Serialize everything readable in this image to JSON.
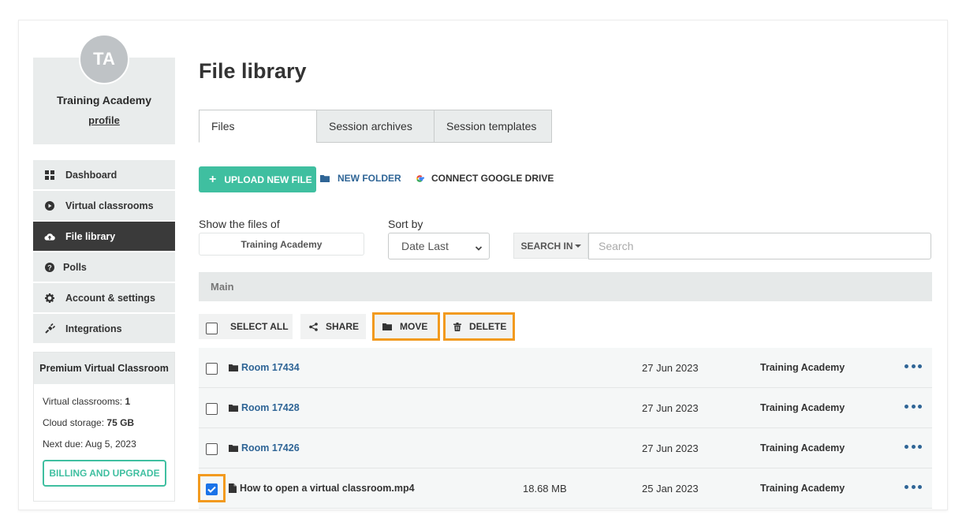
{
  "profile": {
    "initials": "TA",
    "name": "Training Academy",
    "link": "profile"
  },
  "nav": [
    {
      "label": "Dashboard",
      "icon": "dashboard-icon"
    },
    {
      "label": "Virtual classrooms",
      "icon": "play-circle-icon"
    },
    {
      "label": "File library",
      "icon": "cloud-upload-icon",
      "active": true
    },
    {
      "label": "Polls",
      "icon": "question-circle-icon"
    },
    {
      "label": "Account & settings",
      "icon": "gear-icon"
    },
    {
      "label": "Integrations",
      "icon": "plug-icon"
    }
  ],
  "plan": {
    "title": "Premium Virtual Classroom",
    "classrooms_label": "Virtual classrooms:",
    "classrooms_value": "1",
    "storage_label": "Cloud storage:",
    "storage_value": "75 GB",
    "next_due": "Next due: Aug 5, 2023",
    "billing_button": "BILLING AND UPGRADE"
  },
  "page": {
    "title": "File library"
  },
  "tabs": [
    {
      "label": "Files",
      "active": true
    },
    {
      "label": "Session archives"
    },
    {
      "label": "Session templates"
    }
  ],
  "toolbar": {
    "upload": "UPLOAD NEW FILE",
    "new_folder": "NEW FOLDER",
    "google_drive": "CONNECT GOOGLE DRIVE"
  },
  "filters": {
    "show_label": "Show the files of",
    "owner_value": "Training Academy",
    "sort_label": "Sort by",
    "sort_value": "Date Last",
    "search_in": "SEARCH IN",
    "search_placeholder": "Search"
  },
  "folder": {
    "name": "Main"
  },
  "actions": {
    "select_all": "SELECT ALL",
    "share": "SHARE",
    "move": "MOVE",
    "delete": "DELETE"
  },
  "files": [
    {
      "name": "Room 17434",
      "type": "folder",
      "size": "",
      "date": "27 Jun 2023",
      "owner": "Training Academy",
      "checked": false
    },
    {
      "name": "Room 17428",
      "type": "folder",
      "size": "",
      "date": "27 Jun 2023",
      "owner": "Training Academy",
      "checked": false
    },
    {
      "name": "Room 17426",
      "type": "folder",
      "size": "",
      "date": "27 Jun 2023",
      "owner": "Training Academy",
      "checked": false
    },
    {
      "name": "How to open a virtual classroom.mp4",
      "type": "file",
      "size": "18.68 MB",
      "date": "25 Jan 2023",
      "owner": "Training Academy",
      "checked": true
    }
  ],
  "colors": {
    "accent": "#3fbfa0",
    "link": "#2f6596",
    "highlight": "#f29a1f",
    "active_nav": "#3a3a3a"
  }
}
